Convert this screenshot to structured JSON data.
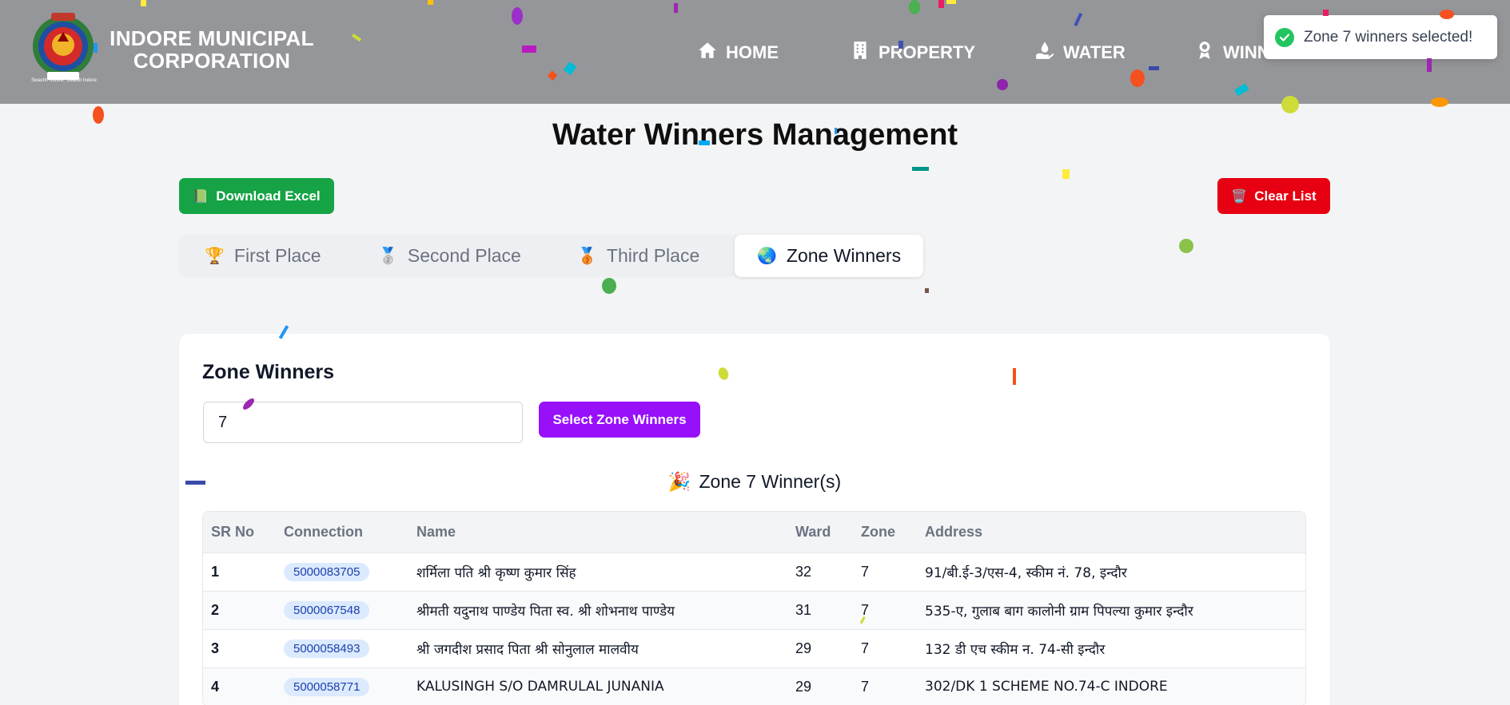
{
  "header": {
    "brand": "INDORE MUNICIPAL CORPORATION",
    "logo_caption": "Swachh Indore, Swasth Indore",
    "nav": [
      {
        "label": "HOME",
        "icon": "home-icon"
      },
      {
        "label": "PROPERTY",
        "icon": "building-icon"
      },
      {
        "label": "WATER",
        "icon": "water-hand-icon"
      },
      {
        "label": "WINN",
        "icon": "award-icon"
      }
    ]
  },
  "toast": {
    "message": "Zone 7 winners selected!",
    "icon": "check-circle-icon",
    "color": "#22c55e"
  },
  "page": {
    "title": "Water Winners Management"
  },
  "actions": {
    "download_label": "Download Excel",
    "download_icon": "📗",
    "clear_label": "Clear List",
    "clear_icon": "🗑️"
  },
  "tabs": [
    {
      "label": "First Place",
      "icon": "🏆",
      "active": false
    },
    {
      "label": "Second Place",
      "icon": "🥈",
      "active": false
    },
    {
      "label": "Third Place",
      "icon": "🥉",
      "active": false
    },
    {
      "label": "Zone Winners",
      "icon": "🌏",
      "active": true
    }
  ],
  "zone_card": {
    "title": "Zone Winners",
    "input_value": "7",
    "select_label": "Select Zone Winners",
    "winners_heading": "Zone 7 Winner(s)",
    "winners_icon": "🎉"
  },
  "table": {
    "columns": [
      "SR No",
      "Connection",
      "Name",
      "Ward",
      "Zone",
      "Address"
    ],
    "rows": [
      {
        "sr": "1",
        "connection": "5000083705",
        "name": "शर्मिला पति श्री कृष्ण कुमार सिंह",
        "ward": "32",
        "zone": "7",
        "address": "91/बी.ई-3/एस-4, स्कीम नं. 78, इन्दौर"
      },
      {
        "sr": "2",
        "connection": "5000067548",
        "name": "श्रीमती यदुनाथ पाण्डेय पिता स्व. श्री शोभनाथ पाण्डेय",
        "ward": "31",
        "zone": "7",
        "address": "535-ए, गुलाब बाग कालोनी ग्राम पिपल्या कुमार इन्दौर"
      },
      {
        "sr": "3",
        "connection": "5000058493",
        "name": "श्री जगदीश प्रसाद पिता श्री सोनुलाल मालवीय",
        "ward": "29",
        "zone": "7",
        "address": "132 डी एच स्कीम न. 74-सी इन्दौर"
      },
      {
        "sr": "4",
        "connection": "5000058771",
        "name": "KALUSINGH S/O DAMRULAL JUNANIA",
        "ward": "29",
        "zone": "7",
        "address": "302/DK 1 SCHEME NO.74-C INDORE"
      }
    ]
  },
  "colors": {
    "header_bg": "#959699",
    "download": "#15a345",
    "clear": "#e60012",
    "select": "#9810fa",
    "badge_bg": "#dbeafe",
    "badge_text": "#1e40af"
  }
}
